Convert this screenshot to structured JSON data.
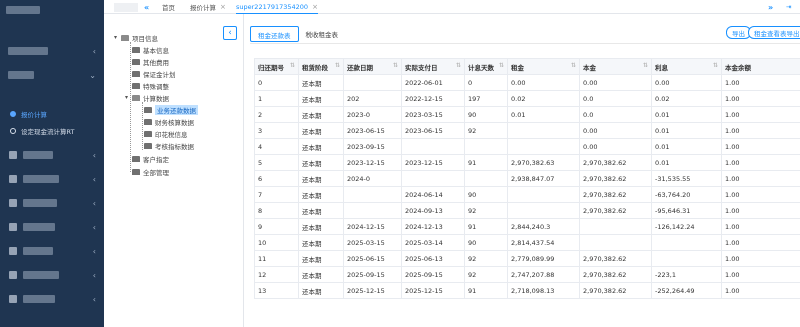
{
  "tabs": {
    "home": "首页",
    "quote": "报价计算",
    "active": "super2217917354200"
  },
  "sidebar": {
    "sub_items": [
      "报价计算",
      "设定现金流计算RT"
    ]
  },
  "tree": {
    "root": "项目信息",
    "nodes": [
      "基本信息",
      "其他费用",
      "保证金计划",
      "特殊调整",
      "计算数据",
      "业务还款数据",
      "财务核算数据",
      "印花税信息",
      "考核指标数据",
      "客户指定",
      "全部管理"
    ]
  },
  "main": {
    "tab_repay": "租金还款表",
    "tab_tax": "税收租金表",
    "btn_export": "导出",
    "btn_export_all": "租金查看表导出"
  },
  "table": {
    "headers": [
      "归还期号",
      "租赁阶段",
      "还款日期",
      "实际支付日",
      "计息天数",
      "租金",
      "本金",
      "利息",
      "本金余额"
    ],
    "rows": [
      [
        "0",
        "还本期",
        "",
        "2022-06-01",
        "0",
        "0.00",
        "0.00",
        "0.00",
        "1.00"
      ],
      [
        "1",
        "还本期",
        "202",
        "2022-12-15",
        "197",
        "0.02",
        "0.0",
        "0.02",
        "1.00"
      ],
      [
        "2",
        "还本期",
        "2023-0",
        "2023-03-15",
        "90",
        "0.01",
        "0.0",
        "0.01",
        "1.00"
      ],
      [
        "3",
        "还本期",
        "2023-06-15",
        "2023-06-15",
        "92",
        "",
        "0.00",
        "0.01",
        "1.00"
      ],
      [
        "4",
        "还本期",
        "2023-09-15",
        "",
        "",
        "",
        "0.00",
        "0.01",
        "1.00"
      ],
      [
        "5",
        "还本期",
        "2023-12-15",
        "2023-12-15",
        "91",
        "2,970,382.63",
        "2,970,382.62",
        "0.01",
        "1.00"
      ],
      [
        "6",
        "还本期",
        "2024-0",
        "",
        "",
        "2,938,847.07",
        "2,970,382.62",
        "-31,535.55",
        "1.00"
      ],
      [
        "7",
        "还本期",
        "",
        "2024-06-14",
        "90",
        "",
        "2,970,382.62",
        "-63,764.20",
        "1.00"
      ],
      [
        "8",
        "还本期",
        "",
        "2024-09-13",
        "92",
        "",
        "2,970,382.62",
        "-95,646.31",
        "1.00"
      ],
      [
        "9",
        "还本期",
        "2024-12-15",
        "2024-12-13",
        "91",
        "2,844,240.3",
        "",
        "-126,142.24",
        "1.00"
      ],
      [
        "10",
        "还本期",
        "2025-03-15",
        "2025-03-14",
        "90",
        "2,814,437.54",
        "",
        "",
        "1.00"
      ],
      [
        "11",
        "还本期",
        "2025-06-15",
        "2025-06-13",
        "92",
        "2,779,089.99",
        "2,970,382.62",
        "",
        "1.00"
      ],
      [
        "12",
        "还本期",
        "2025-09-15",
        "2025-09-15",
        "92",
        "2,747,207.88",
        "2,970,382.62",
        "-223,1",
        "1.00"
      ],
      [
        "13",
        "还本期",
        "2025-12-15",
        "2025-12-15",
        "91",
        "2,718,098.13",
        "2,970,382.62",
        "-252,264.49",
        "1.00"
      ]
    ]
  }
}
